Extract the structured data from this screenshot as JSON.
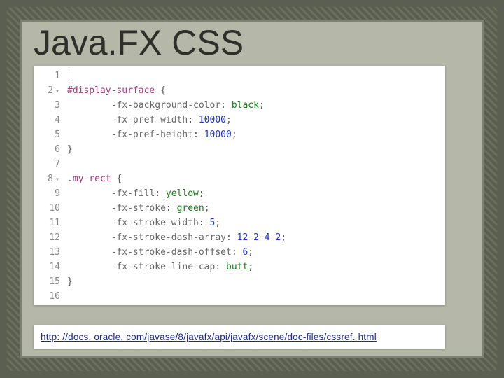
{
  "title": "Java.FX CSS",
  "gutter": [
    "1",
    "2",
    "3",
    "4",
    "5",
    "6",
    "7",
    "8",
    "9",
    "10",
    "11",
    "12",
    "13",
    "14",
    "15",
    "16"
  ],
  "folds": {
    "2": "▾",
    "8": "▾"
  },
  "code": {
    "l1": "",
    "l2_sel": "#display-surface",
    "l2_brace": " {",
    "l3_p": "-fx-background-color",
    "l3_c": ": ",
    "l3_v": "black",
    "l3_e": ";",
    "l4_p": "-fx-pref-width",
    "l4_c": ": ",
    "l4_v": "10000",
    "l4_e": ";",
    "l5_p": "-fx-pref-height",
    "l5_c": ": ",
    "l5_v": "10000",
    "l5_e": ";",
    "l6": "}",
    "l7": "",
    "l8_sel": ".my-rect",
    "l8_brace": " {",
    "l9_p": "-fx-fill",
    "l9_c": ": ",
    "l9_v": "yellow",
    "l9_e": ";",
    "l10_p": "-fx-stroke",
    "l10_c": ": ",
    "l10_v": "green",
    "l10_e": ";",
    "l11_p": "-fx-stroke-width",
    "l11_c": ": ",
    "l11_v": "5",
    "l11_e": ";",
    "l12_p": "-fx-stroke-dash-array",
    "l12_c": ": ",
    "l12_v": "12 2 4 2",
    "l12_e": ";",
    "l13_p": "-fx-stroke-dash-offset",
    "l13_c": ": ",
    "l13_v": "6",
    "l13_e": ";",
    "l14_p": "-fx-stroke-line-cap",
    "l14_c": ": ",
    "l14_v": "butt",
    "l14_e": ";",
    "l15": "}",
    "l16": ""
  },
  "indent1": "        ",
  "link": {
    "text": "http: //docs. oracle. com/javase/8/javafx/api/javafx/scene/doc-files/cssref. html",
    "href": "#"
  }
}
